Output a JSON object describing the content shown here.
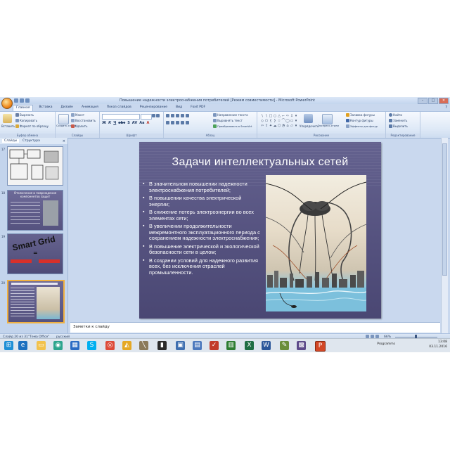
{
  "window": {
    "title": "Повышение надежности электроснабжения потребителей [Режим совместимости] - Microsoft PowerPoint"
  },
  "ribbon": {
    "tabs": [
      "Главная",
      "Вставка",
      "Дизайн",
      "Анимация",
      "Показ слайдов",
      "Рецензирование",
      "Вид",
      "Foxit PDF"
    ],
    "active_tab": "Главная",
    "group_labels": [
      "Буфер обмена",
      "Слайды",
      "Шрифт",
      "Абзац",
      "Рисование",
      "Редактирование"
    ],
    "clipboard": {
      "paste": "Вставить",
      "cut": "Вырезать",
      "copy": "Копировать",
      "format_painter": "Формат по образцу"
    },
    "slides": {
      "new_slide": "Создать слайд",
      "layout": "Макет",
      "reset": "Восстановить",
      "delete": "Удалить"
    },
    "paragraph": {
      "text_direction": "Направление текста",
      "align_text": "Выровнять текст",
      "smartart": "Преобразовать в SmartArt"
    },
    "drawing": {
      "arrange": "Упорядочить",
      "quick_styles": "Экспресс-стили",
      "shape_fill": "Заливка фигуры",
      "shape_outline": "Контур фигуры",
      "shape_effects": "Эффекты для фигур"
    },
    "editing": {
      "find": "Найти",
      "replace": "Заменить",
      "select": "Выделить"
    }
  },
  "left_pane": {
    "tabs": [
      "Слайды",
      "Структура"
    ],
    "close_glyph": "×",
    "slide_numbers": [
      "17",
      "18",
      "19",
      "20"
    ],
    "thumb_texts": {
      "t18_title": "Отключения и повреждения компонентов защит",
      "t19_title": "Smart Grid",
      "t19_equals": "="
    }
  },
  "slide": {
    "title": "Задачи интеллектуальных сетей",
    "bullets": [
      "В значительном повышении надежности электроснабжения потребителей;",
      "В повышении качества электрической энергии;",
      "В снижение потерь электроэнергии во всех элементах сети;",
      "В увеличении продолжительности межремонтного эксплуатационного периода с сохранением надежности электроснабжения;",
      "В повышение электрической и экологической безопасности сети в целом;",
      "В создании условий для надежного развития всех, без исключения отраслей промышленности."
    ]
  },
  "notes": {
    "text": "Заметки к слайду"
  },
  "status_bar": {
    "slide_info": "Слайд 20 из 31",
    "theme": "\"Тема Office\"",
    "language": "русский",
    "zoom": "66%"
  },
  "taskbar": {
    "language": "Programms",
    "time": "13:08",
    "date": "03.11.2016"
  },
  "colors": {
    "ribbon": "#dde8f6",
    "slide_bg": "#5a5785",
    "accent": "#f08a1c"
  }
}
